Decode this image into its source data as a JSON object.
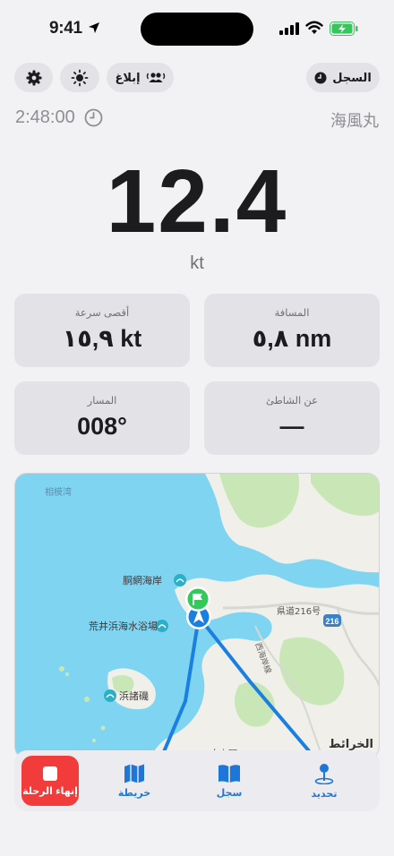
{
  "status": {
    "time": "9:41"
  },
  "controls": {
    "report_label": "إبلاغ",
    "log_label": "السجل"
  },
  "trip": {
    "elapsed": "2:48:00",
    "boat_name": "海風丸"
  },
  "speed": {
    "value": "12.4",
    "unit": "kt"
  },
  "stats": [
    {
      "label": "أقصى سرعة",
      "value": "١٥,٩ kt"
    },
    {
      "label": "المسافة",
      "value": "٥,٨ nm"
    },
    {
      "label": "المسار",
      "value": "008°"
    },
    {
      "label": "عن الشاطئ",
      "value": "—"
    }
  ],
  "map": {
    "labels": {
      "bay": "相模湾",
      "beach1": "胴網海岸",
      "beach2": "荒井浜海水浴場",
      "reef": "浜諸磯",
      "road": "県道216号",
      "route": "216",
      "coast": "西海岸線",
      "town": "白上町",
      "attribution": "الخرائط"
    }
  },
  "tabs": {
    "end": "إنهاء الرحلة",
    "map": "خريطة",
    "log": "سجل",
    "locate": "تحديد"
  },
  "colors": {
    "accent": "#1f76d9",
    "danger": "#f23b3b",
    "flag": "#34c759",
    "track": "#1a7fe0",
    "sea": "#7fd4f2",
    "land": "#f0efe9",
    "green": "#c9e7b6"
  }
}
